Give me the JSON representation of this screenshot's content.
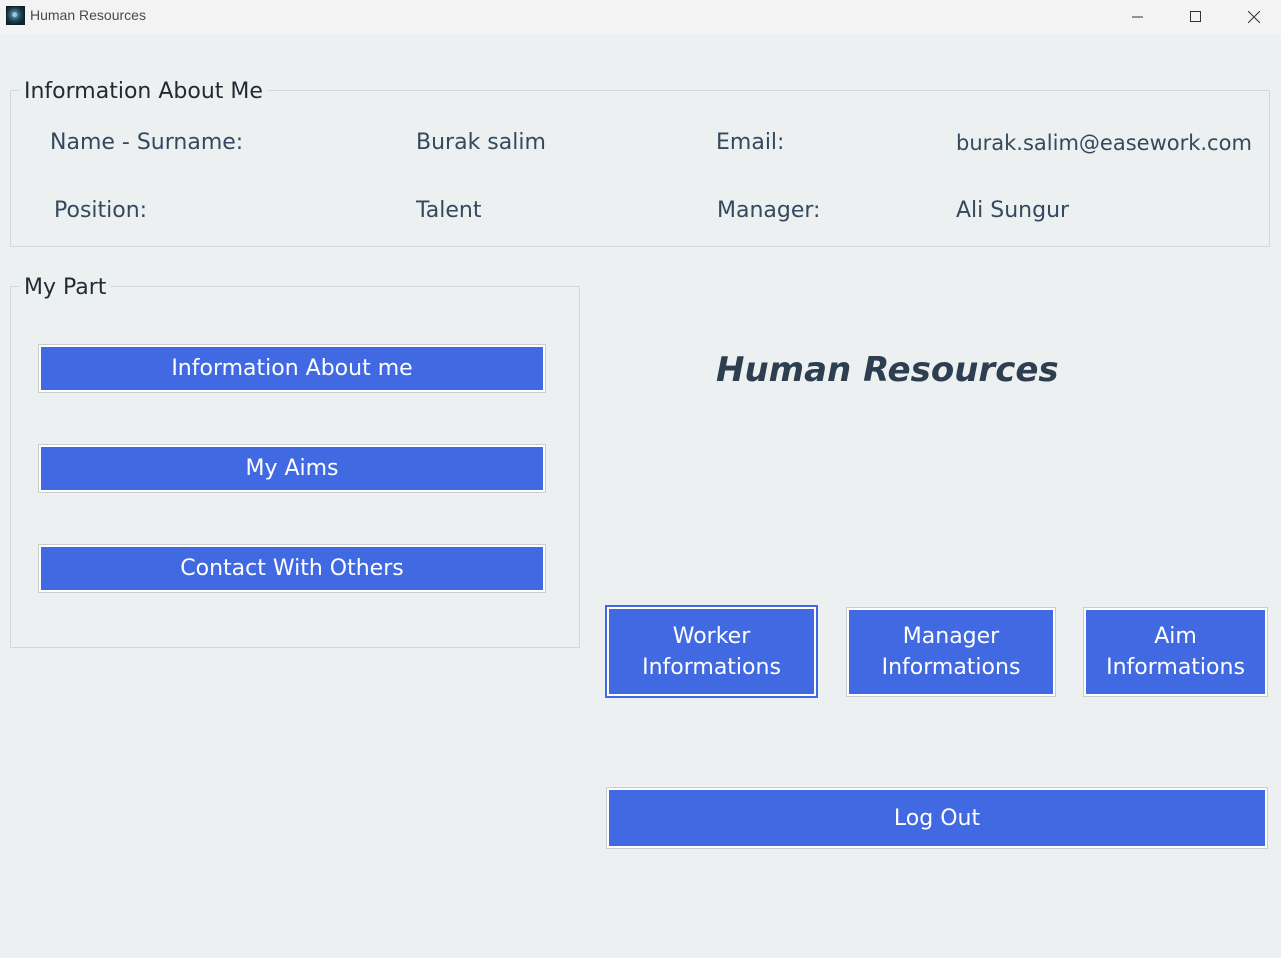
{
  "window": {
    "title": "Human Resources",
    "icon": "app-icon"
  },
  "info_group": {
    "title": "Information About Me",
    "name_label": "Name - Surname:",
    "name_value": "Burak salim",
    "email_label": "Email:",
    "email_value": "burak.salim@easework.com",
    "position_label": "Position:",
    "position_value": "Talent",
    "manager_label": "Manager:",
    "manager_value": "Ali Sungur"
  },
  "my_part": {
    "title": "My Part",
    "buttons": [
      "Information About me",
      "My Aims",
      "Contact With Others"
    ]
  },
  "hero_title": "Human Resources",
  "action_buttons": {
    "worker": [
      "Worker",
      "Informations"
    ],
    "manager": [
      "Manager",
      "Informations"
    ],
    "aim": [
      "Aim",
      "Informations"
    ]
  },
  "logout_label": "Log Out",
  "colors": {
    "accent": "#4169e1",
    "background": "#ecf0f1",
    "text": "#2c3e50"
  }
}
